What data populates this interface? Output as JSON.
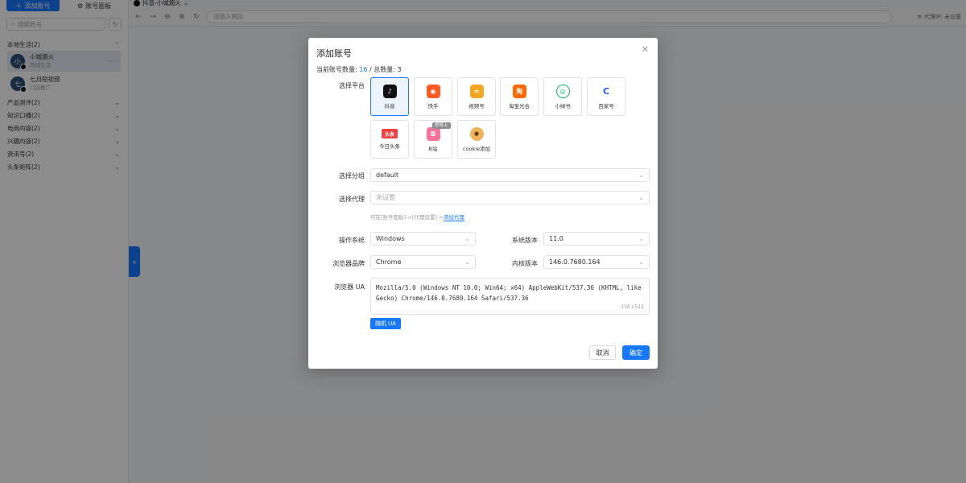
{
  "sidebar": {
    "add_account_label": "添加账号",
    "panel_tab_label": "账号面板",
    "search_placeholder": "搜索账号",
    "groups": [
      {
        "name": "本地生活(2)"
      },
      {
        "name": "产品测评(2)"
      },
      {
        "name": "知识口播(2)"
      },
      {
        "name": "电商内容(2)"
      },
      {
        "name": "兴趣内容(2)"
      },
      {
        "name": "资讯号(2)"
      },
      {
        "name": "头条矩阵(2)"
      }
    ],
    "accounts": [
      {
        "avatar": "小",
        "name": "小城烟火",
        "sub": "同城生活"
      },
      {
        "avatar": "七",
        "name": "七月短视频",
        "sub": "门店推广"
      }
    ]
  },
  "browser": {
    "tab_title": "抖音-小城烟火",
    "url_placeholder": "请输入网址",
    "proxy_status": "代理IP: 未设置"
  },
  "modal": {
    "title": "添加账号",
    "count_prefix": "当前账号数量: ",
    "count_current": "16",
    "count_sep": " / 总数量: ",
    "count_total": "3",
    "labels": {
      "platform": "选择平台",
      "group": "选择分组",
      "proxy": "选择代理",
      "os": "操作系统",
      "os_version": "系统版本",
      "browser": "浏览器品牌",
      "kernel": "内核版本",
      "ua": "浏览器 UA"
    },
    "platforms": [
      {
        "label": "抖音",
        "icon": "douyin-icon",
        "color": "#111111",
        "glyph": "♪"
      },
      {
        "label": "快手",
        "icon": "kuaishou-icon",
        "color": "#ff5a1f",
        "glyph": "◉"
      },
      {
        "label": "视频号",
        "icon": "shipinhao-icon",
        "color": "#f5a623",
        "glyph": "≈"
      },
      {
        "label": "淘宝光合",
        "icon": "taobao-icon",
        "color": "#ff6a00",
        "glyph": "淘"
      },
      {
        "label": "小绿书",
        "icon": "xiaolvshu-icon",
        "color": "#07c160",
        "glyph": "◎"
      },
      {
        "label": "百家号",
        "icon": "baijiahao-icon",
        "color": "#2b5bf5",
        "glyph": "C"
      },
      {
        "label": "今日头条",
        "icon": "toutiao-icon",
        "color": "#f04142",
        "glyph": "头条"
      },
      {
        "label": "B站",
        "icon": "bilibili-icon",
        "color": "#fb7299",
        "glyph": "B",
        "tag": "即将上"
      },
      {
        "label": "cookie添加",
        "icon": "cookie-icon",
        "color": "#ffffff",
        "glyph": "🍪"
      }
    ],
    "group_value": "default",
    "proxy_placeholder": "未设置",
    "proxy_hint_prefix": "可在[账号面板]->[代理设置]->",
    "proxy_hint_link": "添加代理",
    "os_value": "Windows",
    "os_version_value": "11.0",
    "browser_value": "Chrome",
    "kernel_value": "146.0.7680.164",
    "ua_value": "Mozilla/5.0 (Windows NT 10.0; Win64; x64) AppleWebKit/537.36 (KHTML, like Gecko) Chrome/146.0.7680.164 Safari/537.36",
    "ua_count": "116 / 512",
    "random_ua_label": "随机 UA",
    "cancel_label": "取消",
    "ok_label": "确定"
  },
  "colors": {
    "accent": "#1677ff"
  }
}
